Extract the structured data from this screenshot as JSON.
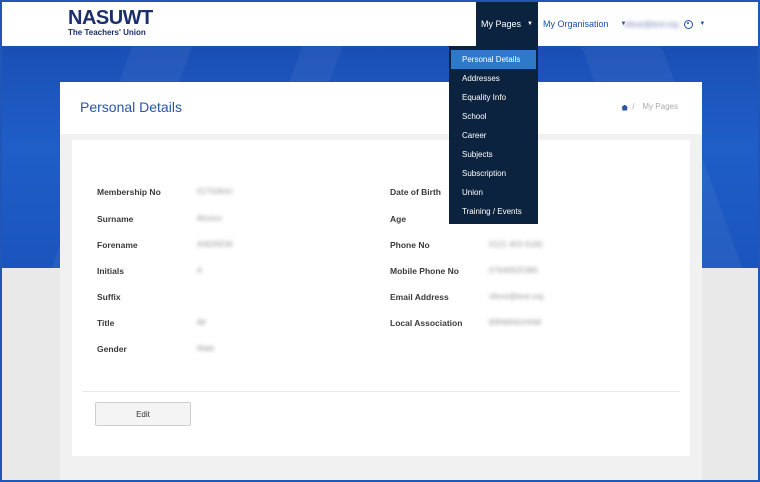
{
  "brand": {
    "name": "NASUWT",
    "tagline": "The Teachers' Union"
  },
  "nav": {
    "my_pages": "My Pages",
    "my_organisation": "My Organisation",
    "user_email": "ofexe@test.org"
  },
  "dropdown": {
    "items": [
      {
        "label": "Personal Details",
        "active": true
      },
      {
        "label": "Addresses",
        "active": false
      },
      {
        "label": "Equality Info",
        "active": false
      },
      {
        "label": "School",
        "active": false
      },
      {
        "label": "Career",
        "active": false
      },
      {
        "label": "Subjects",
        "active": false
      },
      {
        "label": "Subscription",
        "active": false
      },
      {
        "label": "Union",
        "active": false
      },
      {
        "label": "Training / Events",
        "active": false
      }
    ]
  },
  "page": {
    "title": "Personal Details",
    "breadcrumb_current": "My Pages",
    "breadcrumb_sep": "/"
  },
  "details": {
    "left": [
      {
        "label": "Membership No",
        "value": "01T5064J"
      },
      {
        "label": "Surname",
        "value": "Morton"
      },
      {
        "label": "Forename",
        "value": "ANDREW"
      },
      {
        "label": "Initials",
        "value": "A"
      },
      {
        "label": "Suffix",
        "value": ""
      },
      {
        "label": "Title",
        "value": "Mr"
      },
      {
        "label": "Gender",
        "value": "Male"
      }
    ],
    "right": [
      {
        "label": "Date of Birth",
        "value": ""
      },
      {
        "label": "Age",
        "value": ""
      },
      {
        "label": "Phone No",
        "value": "0121 453 6160"
      },
      {
        "label": "Mobile Phone No",
        "value": "07640925385"
      },
      {
        "label": "Email Address",
        "value": "ofexe@test.org"
      },
      {
        "label": "Local Association",
        "value": "BIRMINGHAM"
      }
    ]
  },
  "actions": {
    "edit_label": "Edit"
  },
  "colors": {
    "navy": "#0c2340",
    "brand_blue": "#1f5ec7",
    "active_item": "#2e79c8",
    "title_blue": "#2a56a5"
  }
}
